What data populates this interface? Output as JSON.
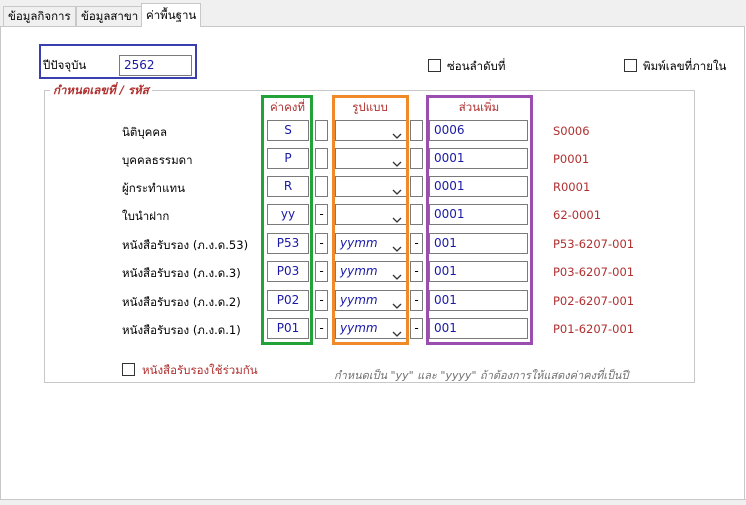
{
  "tabs": [
    {
      "label": "ข้อมูลกิจการ"
    },
    {
      "label": "ข้อมูลสาขา"
    },
    {
      "label": "ค่าพื้นฐาน"
    }
  ],
  "year": {
    "label": "ปีปัจจุบัน",
    "value": "2562"
  },
  "options": {
    "hide_sequence": "ซ่อนลำดับที่",
    "print_internal": "พิมพ์เลขที่ภายใน"
  },
  "group": {
    "title": "กำหนดเลขที่ / รหัส",
    "col_constant": "ค่าคงที่",
    "col_format": "รูปแบบ",
    "col_extra": "ส่วนเพิ่ม"
  },
  "rows": [
    {
      "label": "นิติบุคคล",
      "constant": "S",
      "sep1": "",
      "format": "",
      "sep2": "",
      "extra": "0006",
      "example": "S0006"
    },
    {
      "label": "บุคคลธรรมดา",
      "constant": "P",
      "sep1": "",
      "format": "",
      "sep2": "",
      "extra": "0001",
      "example": "P0001"
    },
    {
      "label": "ผู้กระทำแทน",
      "constant": "R",
      "sep1": "",
      "format": "",
      "sep2": "",
      "extra": "0001",
      "example": "R0001"
    },
    {
      "label": "ใบนำฝาก",
      "constant": "yy",
      "sep1": "-",
      "format": "",
      "sep2": "",
      "extra": "0001",
      "example": "62-0001"
    },
    {
      "label": "หนังสือรับรอง (ภ.ง.ด.53)",
      "constant": "P53",
      "sep1": "-",
      "format": "yymm",
      "sep2": "-",
      "extra": "001",
      "example": "P53-6207-001"
    },
    {
      "label": "หนังสือรับรอง (ภ.ง.ด.3)",
      "constant": "P03",
      "sep1": "-",
      "format": "yymm",
      "sep2": "-",
      "extra": "001",
      "example": "P03-6207-001"
    },
    {
      "label": "หนังสือรับรอง (ภ.ง.ด.2)",
      "constant": "P02",
      "sep1": "-",
      "format": "yymm",
      "sep2": "-",
      "extra": "001",
      "example": "P02-6207-001"
    },
    {
      "label": "หนังสือรับรอง (ภ.ง.ด.1)",
      "constant": "P01",
      "sep1": "-",
      "format": "yymm",
      "sep2": "-",
      "extra": "001",
      "example": "P01-6207-001"
    }
  ],
  "shared_cert": "หนังสือรับรองใช้ร่วมกัน",
  "note": "กำหนดเป็น \"yy\" และ \"yyyy\" ถ้าต้องการให้แสดงค่าคงที่เป็นปี",
  "colors": {
    "highlight_year": "#3a3fb0",
    "highlight_constant": "#23a23a",
    "highlight_format": "#f08a28",
    "highlight_extra": "#9a4fb0",
    "accent_red": "#b03030",
    "value_blue": "#1a1aa6"
  }
}
